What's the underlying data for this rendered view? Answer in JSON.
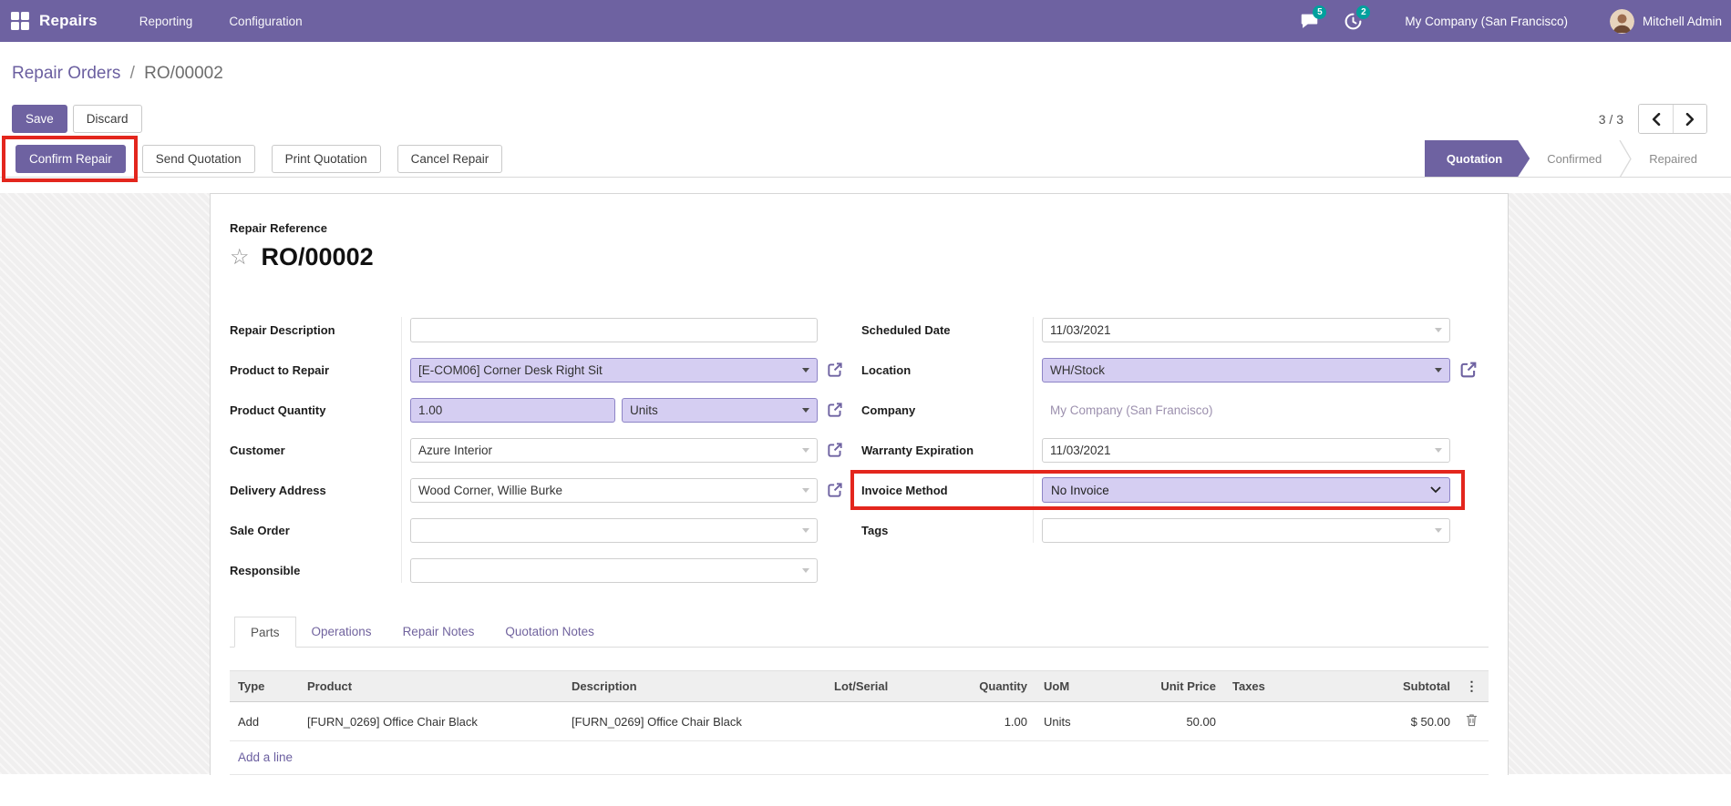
{
  "navbar": {
    "app_name": "Repairs",
    "menu_reporting": "Reporting",
    "menu_configuration": "Configuration",
    "messages_badge": "5",
    "activities_badge": "2",
    "company": "My Company (San Francisco)",
    "user": "Mitchell Admin"
  },
  "breadcrumb": {
    "parent": "Repair Orders",
    "separator": "/",
    "current": "RO/00002"
  },
  "control_panel": {
    "save_label": "Save",
    "discard_label": "Discard",
    "pager": "3 / 3"
  },
  "statusbar": {
    "confirm_label": "Confirm Repair",
    "send_label": "Send Quotation",
    "print_label": "Print Quotation",
    "cancel_label": "Cancel Repair",
    "state_quotation": "Quotation",
    "state_confirmed": "Confirmed",
    "state_repaired": "Repaired"
  },
  "form": {
    "reference_label": "Repair Reference",
    "reference_value": "RO/00002",
    "fields": {
      "repair_description": {
        "label": "Repair Description",
        "value": ""
      },
      "product_to_repair": {
        "label": "Product to Repair",
        "value": "[E-COM06] Corner Desk Right Sit"
      },
      "product_quantity": {
        "label": "Product Quantity",
        "value": "1.00",
        "uom": "Units"
      },
      "customer": {
        "label": "Customer",
        "value": "Azure Interior"
      },
      "delivery_address": {
        "label": "Delivery Address",
        "value": "Wood Corner, Willie Burke"
      },
      "sale_order": {
        "label": "Sale Order",
        "value": ""
      },
      "responsible": {
        "label": "Responsible",
        "value": ""
      },
      "scheduled_date": {
        "label": "Scheduled Date",
        "value": "11/03/2021"
      },
      "location": {
        "label": "Location",
        "value": "WH/Stock"
      },
      "company": {
        "label": "Company",
        "value": "My Company (San Francisco)"
      },
      "warranty_expiration": {
        "label": "Warranty Expiration",
        "value": "11/03/2021"
      },
      "invoice_method": {
        "label": "Invoice Method",
        "value": "No Invoice"
      },
      "tags": {
        "label": "Tags",
        "value": ""
      }
    }
  },
  "tabs": {
    "parts": "Parts",
    "operations": "Operations",
    "repair_notes": "Repair Notes",
    "quotation_notes": "Quotation Notes"
  },
  "parts_table": {
    "columns": [
      "Type",
      "Product",
      "Description",
      "Lot/Serial",
      "Quantity",
      "UoM",
      "Unit Price",
      "Taxes",
      "Subtotal"
    ],
    "kebab": "⋮",
    "rows": [
      {
        "type": "Add",
        "product": "[FURN_0269] Office Chair Black",
        "description": "[FURN_0269] Office Chair Black",
        "lot_serial": "",
        "quantity": "1.00",
        "uom": "Units",
        "unit_price": "50.00",
        "taxes": "",
        "subtotal": "$ 50.00"
      }
    ],
    "add_line_label": "Add a line"
  },
  "colors": {
    "accent_purple": "#6e62a1",
    "badge_teal": "#00a09d",
    "highlight_red": "#e3261d",
    "field_lavender": "#d5cef2"
  }
}
